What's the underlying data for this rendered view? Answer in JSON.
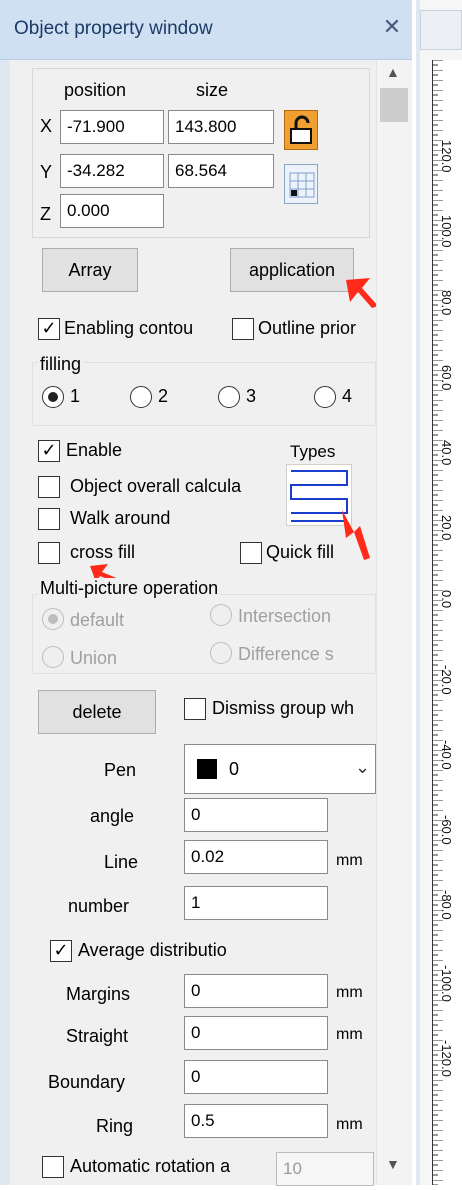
{
  "window": {
    "title": "Object property window"
  },
  "geometry": {
    "position_label": "position",
    "size_label": "size",
    "x_label": "X",
    "y_label": "Y",
    "z_label": "Z",
    "x_position": "-71.900",
    "x_size": "143.800",
    "y_position": "-34.282",
    "y_size": "68.564",
    "z_value": "0.000"
  },
  "buttons": {
    "array": "Array",
    "application": "application",
    "delete": "delete"
  },
  "contour": {
    "enabling_contour": "Enabling contou",
    "outline_priority": "Outline prior"
  },
  "filling": {
    "label": "filling",
    "options": [
      "1",
      "2",
      "3",
      "4"
    ],
    "selected": "1"
  },
  "fill_options": {
    "enable": "Enable",
    "types_label": "Types",
    "object_overall": "Object overall calcula",
    "walk_around": "Walk around",
    "cross_fill": "cross fill",
    "quick_fill": "Quick fill"
  },
  "multi_picture": {
    "label": "Multi-picture operation",
    "default": "default",
    "intersection": "Intersection",
    "union": "Union",
    "difference": "Difference s"
  },
  "group": {
    "dismiss_group": "Dismiss group wh"
  },
  "params": {
    "pen_label": "Pen",
    "pen_value": "0",
    "angle_label": "angle",
    "angle_value": "0",
    "line_label": "Line",
    "line_value": "0.02",
    "line_unit": "mm",
    "number_label": "number",
    "number_value": "1",
    "average_distribution": "Average distributio",
    "margins_label": "Margins",
    "margins_value": "0",
    "margins_unit": "mm",
    "straight_label": "Straight",
    "straight_value": "0",
    "straight_unit": "mm",
    "boundary_label": "Boundary",
    "boundary_value": "0",
    "ring_label": "Ring",
    "ring_value": "0.5",
    "ring_unit": "mm",
    "auto_rotation": "Automatic rotation a",
    "auto_rotation_value": "10"
  },
  "ruler": {
    "labels": [
      "120.0",
      "100.0",
      "80.0",
      "60.0",
      "40.0",
      "20.0",
      "0.0",
      "-20.0",
      "-40.0",
      "-60.0",
      "-80.0",
      "-100.0",
      "-120.0"
    ]
  },
  "colors": {
    "accent_arrow": "#ff2a1a",
    "lock_orange": "#f0a030",
    "titlebar": "#cfe0f3"
  }
}
